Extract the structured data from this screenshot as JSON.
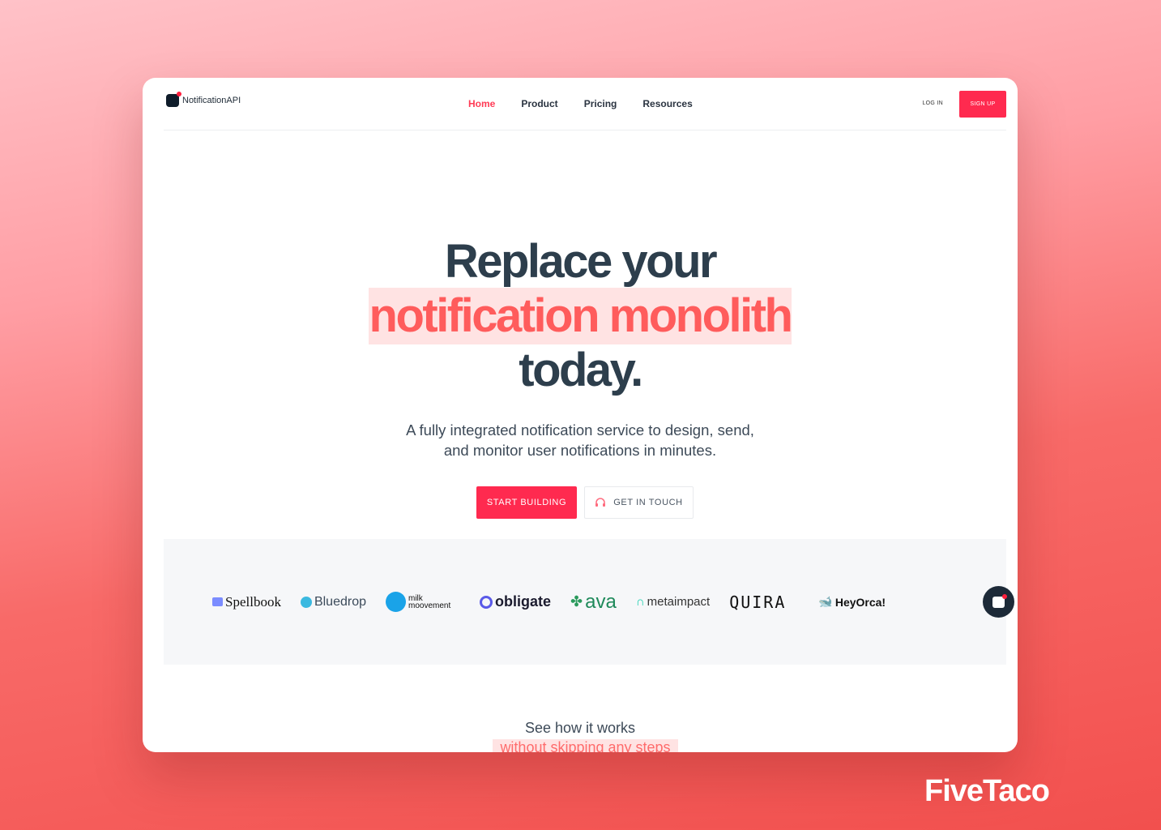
{
  "brand": "NotificationAPI",
  "nav": {
    "items": [
      "Home",
      "Product",
      "Pricing",
      "Resources"
    ],
    "active": "Home",
    "login": "LOG IN",
    "signup": "SIGN UP"
  },
  "hero": {
    "line1": "Replace your",
    "line2": "notification monolith",
    "line3": "today.",
    "subtitle1": "A fully integrated notification service to design, send,",
    "subtitle2": "and monitor user notifications in minutes.",
    "cta_primary": "START BUILDING",
    "cta_secondary": "GET IN TOUCH"
  },
  "logos": [
    "Spellbook",
    "Bluedrop",
    "milk moovement",
    "obligate",
    "ava",
    "metaimpact",
    "QUIRA",
    "HeyOrca!"
  ],
  "section": {
    "title": "See how it works",
    "subtitle": "without skipping any steps"
  },
  "watermark": "FiveTaco",
  "colors": {
    "accent": "#ff2a4f",
    "highlight_text": "#ff5c5c",
    "highlight_bg": "#ffe3e3",
    "heading": "#2d3e4c"
  }
}
